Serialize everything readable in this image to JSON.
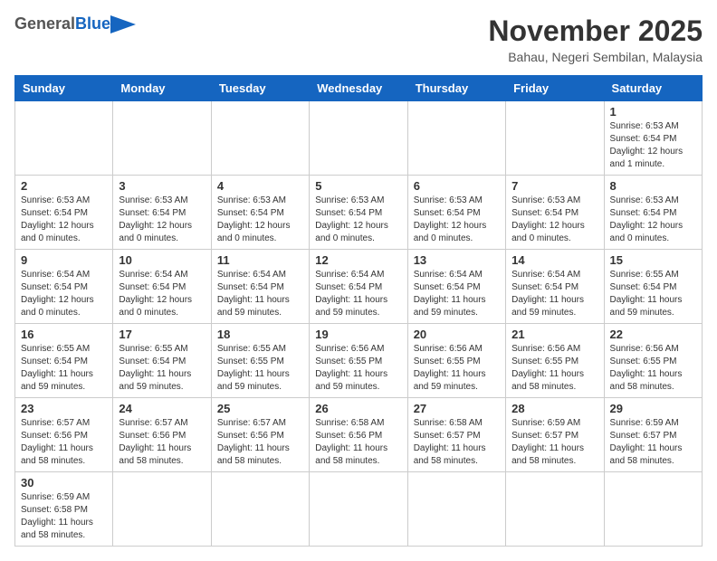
{
  "header": {
    "logo_general": "General",
    "logo_blue": "Blue",
    "month_title": "November 2025",
    "location": "Bahau, Negeri Sembilan, Malaysia"
  },
  "days_of_week": [
    "Sunday",
    "Monday",
    "Tuesday",
    "Wednesday",
    "Thursday",
    "Friday",
    "Saturday"
  ],
  "weeks": [
    [
      {
        "day": "",
        "info": ""
      },
      {
        "day": "",
        "info": ""
      },
      {
        "day": "",
        "info": ""
      },
      {
        "day": "",
        "info": ""
      },
      {
        "day": "",
        "info": ""
      },
      {
        "day": "",
        "info": ""
      },
      {
        "day": "1",
        "info": "Sunrise: 6:53 AM\nSunset: 6:54 PM\nDaylight: 12 hours\nand 1 minute."
      }
    ],
    [
      {
        "day": "2",
        "info": "Sunrise: 6:53 AM\nSunset: 6:54 PM\nDaylight: 12 hours\nand 0 minutes."
      },
      {
        "day": "3",
        "info": "Sunrise: 6:53 AM\nSunset: 6:54 PM\nDaylight: 12 hours\nand 0 minutes."
      },
      {
        "day": "4",
        "info": "Sunrise: 6:53 AM\nSunset: 6:54 PM\nDaylight: 12 hours\nand 0 minutes."
      },
      {
        "day": "5",
        "info": "Sunrise: 6:53 AM\nSunset: 6:54 PM\nDaylight: 12 hours\nand 0 minutes."
      },
      {
        "day": "6",
        "info": "Sunrise: 6:53 AM\nSunset: 6:54 PM\nDaylight: 12 hours\nand 0 minutes."
      },
      {
        "day": "7",
        "info": "Sunrise: 6:53 AM\nSunset: 6:54 PM\nDaylight: 12 hours\nand 0 minutes."
      },
      {
        "day": "8",
        "info": "Sunrise: 6:53 AM\nSunset: 6:54 PM\nDaylight: 12 hours\nand 0 minutes."
      }
    ],
    [
      {
        "day": "9",
        "info": "Sunrise: 6:54 AM\nSunset: 6:54 PM\nDaylight: 12 hours\nand 0 minutes."
      },
      {
        "day": "10",
        "info": "Sunrise: 6:54 AM\nSunset: 6:54 PM\nDaylight: 12 hours\nand 0 minutes."
      },
      {
        "day": "11",
        "info": "Sunrise: 6:54 AM\nSunset: 6:54 PM\nDaylight: 11 hours\nand 59 minutes."
      },
      {
        "day": "12",
        "info": "Sunrise: 6:54 AM\nSunset: 6:54 PM\nDaylight: 11 hours\nand 59 minutes."
      },
      {
        "day": "13",
        "info": "Sunrise: 6:54 AM\nSunset: 6:54 PM\nDaylight: 11 hours\nand 59 minutes."
      },
      {
        "day": "14",
        "info": "Sunrise: 6:54 AM\nSunset: 6:54 PM\nDaylight: 11 hours\nand 59 minutes."
      },
      {
        "day": "15",
        "info": "Sunrise: 6:55 AM\nSunset: 6:54 PM\nDaylight: 11 hours\nand 59 minutes."
      }
    ],
    [
      {
        "day": "16",
        "info": "Sunrise: 6:55 AM\nSunset: 6:54 PM\nDaylight: 11 hours\nand 59 minutes."
      },
      {
        "day": "17",
        "info": "Sunrise: 6:55 AM\nSunset: 6:54 PM\nDaylight: 11 hours\nand 59 minutes."
      },
      {
        "day": "18",
        "info": "Sunrise: 6:55 AM\nSunset: 6:55 PM\nDaylight: 11 hours\nand 59 minutes."
      },
      {
        "day": "19",
        "info": "Sunrise: 6:56 AM\nSunset: 6:55 PM\nDaylight: 11 hours\nand 59 minutes."
      },
      {
        "day": "20",
        "info": "Sunrise: 6:56 AM\nSunset: 6:55 PM\nDaylight: 11 hours\nand 59 minutes."
      },
      {
        "day": "21",
        "info": "Sunrise: 6:56 AM\nSunset: 6:55 PM\nDaylight: 11 hours\nand 58 minutes."
      },
      {
        "day": "22",
        "info": "Sunrise: 6:56 AM\nSunset: 6:55 PM\nDaylight: 11 hours\nand 58 minutes."
      }
    ],
    [
      {
        "day": "23",
        "info": "Sunrise: 6:57 AM\nSunset: 6:56 PM\nDaylight: 11 hours\nand 58 minutes."
      },
      {
        "day": "24",
        "info": "Sunrise: 6:57 AM\nSunset: 6:56 PM\nDaylight: 11 hours\nand 58 minutes."
      },
      {
        "day": "25",
        "info": "Sunrise: 6:57 AM\nSunset: 6:56 PM\nDaylight: 11 hours\nand 58 minutes."
      },
      {
        "day": "26",
        "info": "Sunrise: 6:58 AM\nSunset: 6:56 PM\nDaylight: 11 hours\nand 58 minutes."
      },
      {
        "day": "27",
        "info": "Sunrise: 6:58 AM\nSunset: 6:57 PM\nDaylight: 11 hours\nand 58 minutes."
      },
      {
        "day": "28",
        "info": "Sunrise: 6:59 AM\nSunset: 6:57 PM\nDaylight: 11 hours\nand 58 minutes."
      },
      {
        "day": "29",
        "info": "Sunrise: 6:59 AM\nSunset: 6:57 PM\nDaylight: 11 hours\nand 58 minutes."
      }
    ],
    [
      {
        "day": "30",
        "info": "Sunrise: 6:59 AM\nSunset: 6:58 PM\nDaylight: 11 hours\nand 58 minutes."
      },
      {
        "day": "",
        "info": ""
      },
      {
        "day": "",
        "info": ""
      },
      {
        "day": "",
        "info": ""
      },
      {
        "day": "",
        "info": ""
      },
      {
        "day": "",
        "info": ""
      },
      {
        "day": "",
        "info": ""
      }
    ]
  ]
}
